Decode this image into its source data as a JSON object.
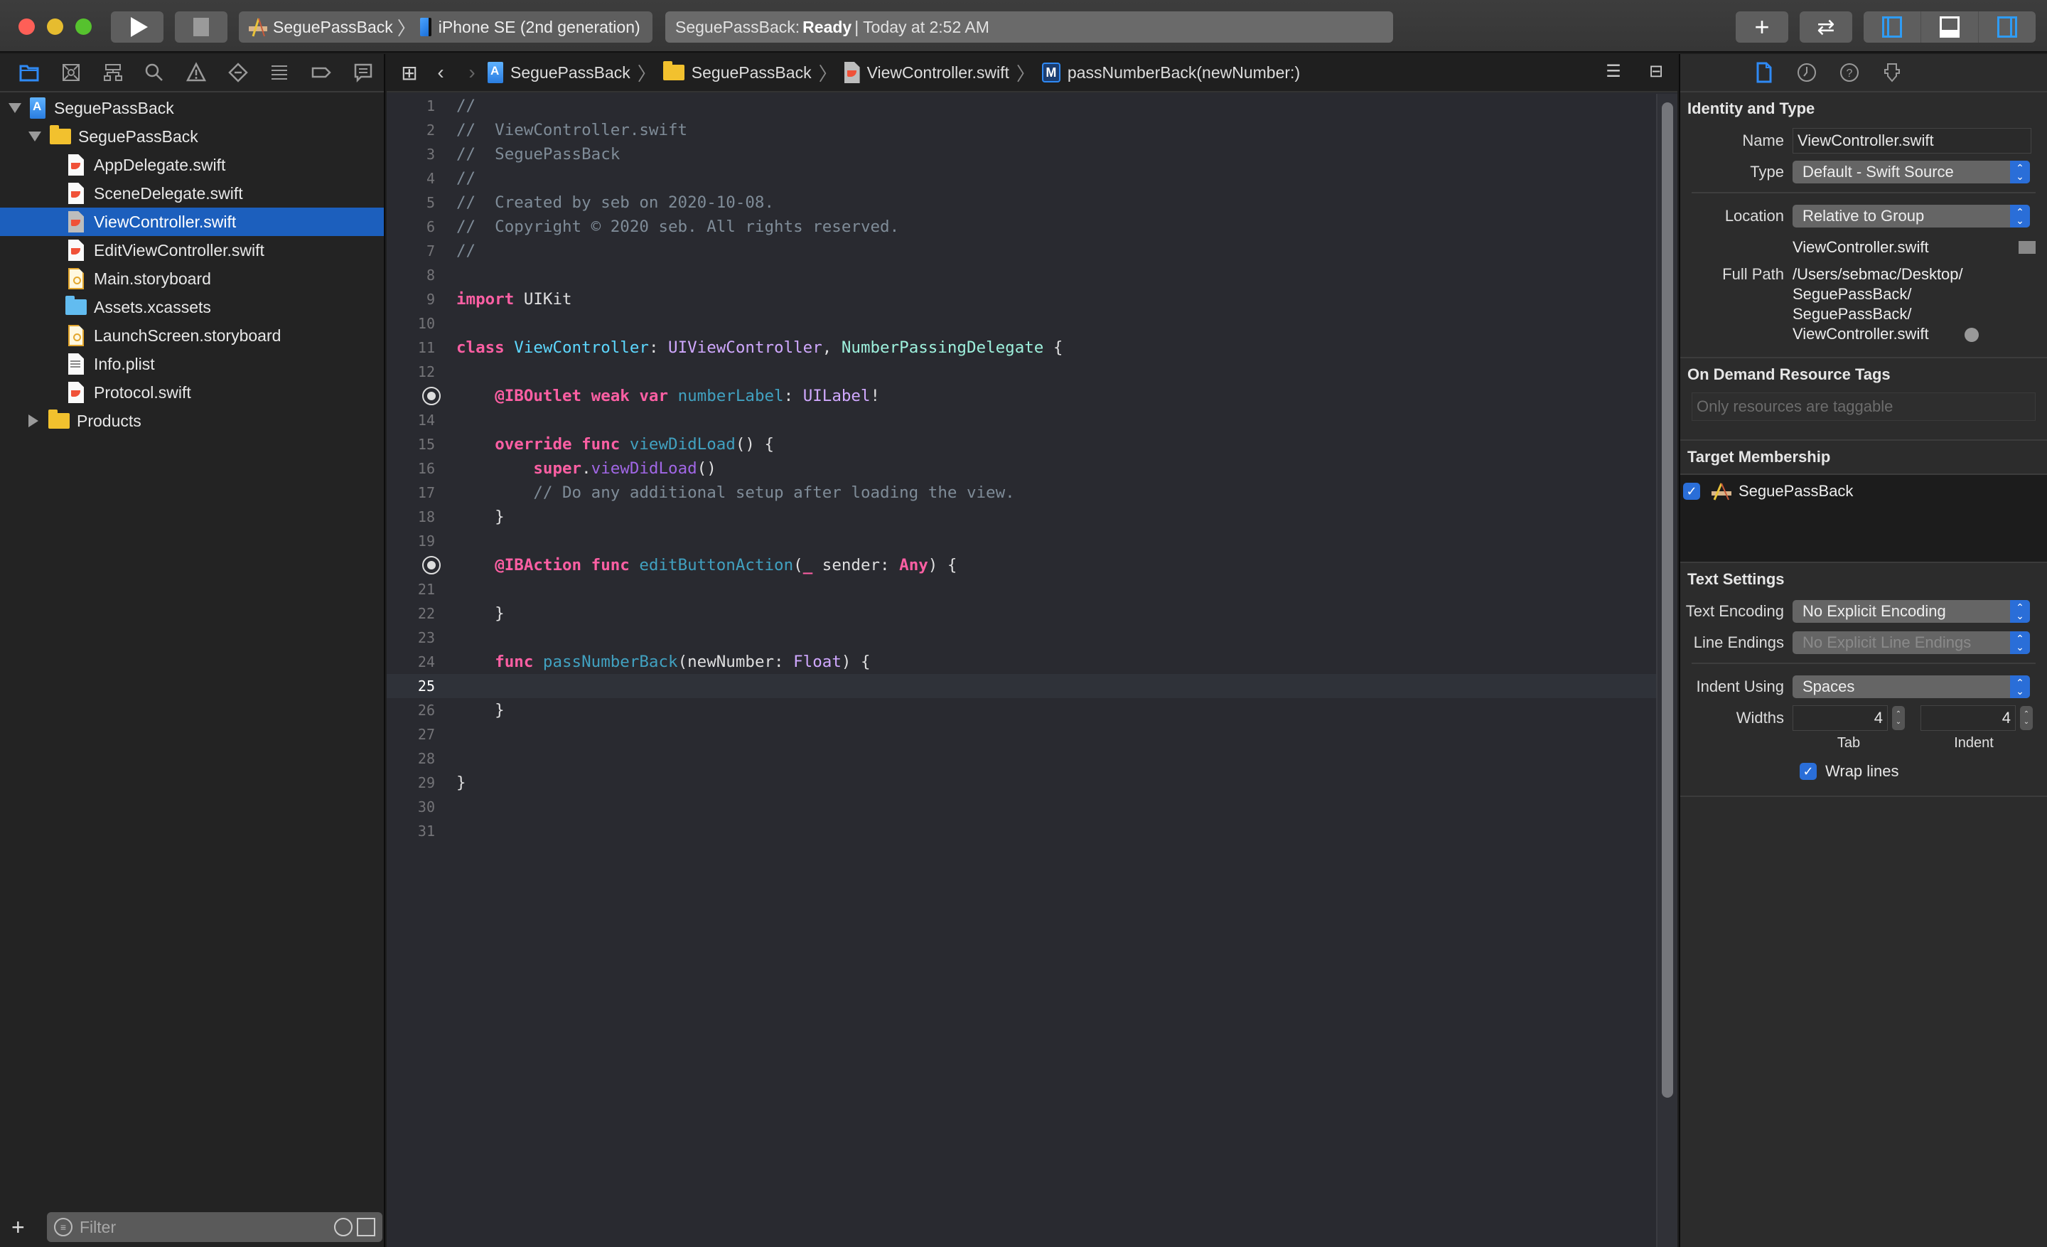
{
  "toolbar": {
    "scheme": "SeguePassBack",
    "destination": "iPhone SE (2nd generation)",
    "activity": {
      "project": "SeguePassBack:",
      "status": "Ready",
      "time": "| Today at 2:52 AM"
    },
    "run_icon": "play-icon",
    "stop_icon": "stop-icon",
    "add_icon": "plus-icon",
    "review_icon": "swap-arrows-icon",
    "pane_icons": [
      "navigator-pane-icon",
      "debug-area-icon",
      "inspector-pane-icon"
    ]
  },
  "navigator": {
    "tabs": [
      {
        "name": "project-navigator",
        "active": true
      },
      {
        "name": "source-control-navigator"
      },
      {
        "name": "symbol-navigator"
      },
      {
        "name": "find-navigator"
      },
      {
        "name": "issue-navigator"
      },
      {
        "name": "test-navigator"
      },
      {
        "name": "debug-navigator"
      },
      {
        "name": "breakpoint-navigator"
      },
      {
        "name": "report-navigator"
      }
    ],
    "tree": [
      {
        "label": "SeguePassBack",
        "kind": "project",
        "depth": 0,
        "expanded": true
      },
      {
        "label": "SeguePassBack",
        "kind": "folder",
        "depth": 1,
        "expanded": true
      },
      {
        "label": "AppDelegate.swift",
        "kind": "swift",
        "depth": 2
      },
      {
        "label": "SceneDelegate.swift",
        "kind": "swift",
        "depth": 2
      },
      {
        "label": "ViewController.swift",
        "kind": "swift",
        "depth": 2,
        "selected": true
      },
      {
        "label": "EditViewController.swift",
        "kind": "swift",
        "depth": 2
      },
      {
        "label": "Main.storyboard",
        "kind": "storyboard",
        "depth": 2
      },
      {
        "label": "Assets.xcassets",
        "kind": "assets",
        "depth": 2
      },
      {
        "label": "LaunchScreen.storyboard",
        "kind": "storyboard",
        "depth": 2
      },
      {
        "label": "Info.plist",
        "kind": "plist",
        "depth": 2
      },
      {
        "label": "Protocol.swift",
        "kind": "swift",
        "depth": 2
      },
      {
        "label": "Products",
        "kind": "folder",
        "depth": 1,
        "expanded": false
      }
    ],
    "filter_placeholder": "Filter"
  },
  "editor": {
    "jumpbar": [
      "SeguePassBack",
      "SeguePassBack",
      "ViewController.swift",
      "passNumberBack(newNumber:)"
    ],
    "method_badge": "M",
    "current_line": 25,
    "lines": [
      [
        [
          "cm",
          "//"
        ]
      ],
      [
        [
          "cm",
          "//  ViewController.swift"
        ]
      ],
      [
        [
          "cm",
          "//  SeguePassBack"
        ]
      ],
      [
        [
          "cm",
          "//"
        ]
      ],
      [
        [
          "cm",
          "//  Created by seb on 2020-10-08."
        ]
      ],
      [
        [
          "cm",
          "//  Copyright © 2020 seb. All rights reserved."
        ]
      ],
      [
        [
          "cm",
          "//"
        ]
      ],
      [],
      [
        [
          "kw",
          "import"
        ],
        [
          "plain",
          " UIKit"
        ]
      ],
      [],
      [
        [
          "kw",
          "class"
        ],
        [
          "plain",
          " "
        ],
        [
          "cls",
          "ViewController"
        ],
        [
          "plain",
          ": "
        ],
        [
          "type",
          "UIViewController"
        ],
        [
          "plain",
          ", "
        ],
        [
          "proto",
          "NumberPassingDelegate"
        ],
        [
          "plain",
          " {"
        ]
      ],
      [],
      [
        [
          "plain",
          "    "
        ],
        [
          "kw",
          "@IBOutlet"
        ],
        [
          "plain",
          " "
        ],
        [
          "kw",
          "weak"
        ],
        [
          "plain",
          " "
        ],
        [
          "kw",
          "var"
        ],
        [
          "plain",
          " "
        ],
        [
          "func",
          "numberLabel"
        ],
        [
          "plain",
          ": "
        ],
        [
          "type",
          "UILabel"
        ],
        [
          "plain",
          "!"
        ]
      ],
      [],
      [
        [
          "plain",
          "    "
        ],
        [
          "kw",
          "override"
        ],
        [
          "plain",
          " "
        ],
        [
          "kw",
          "func"
        ],
        [
          "plain",
          " "
        ],
        [
          "func",
          "viewDidLoad"
        ],
        [
          "plain",
          "() {"
        ]
      ],
      [
        [
          "plain",
          "        "
        ],
        [
          "kw",
          "super"
        ],
        [
          "plain",
          "."
        ],
        [
          "meth",
          "viewDidLoad"
        ],
        [
          "plain",
          "()"
        ]
      ],
      [
        [
          "plain",
          "        "
        ],
        [
          "cm",
          "// Do any additional setup after loading the view."
        ]
      ],
      [
        [
          "plain",
          "    }"
        ]
      ],
      [],
      [
        [
          "plain",
          "    "
        ],
        [
          "kw",
          "@IBAction"
        ],
        [
          "plain",
          " "
        ],
        [
          "kw",
          "func"
        ],
        [
          "plain",
          " "
        ],
        [
          "func",
          "editButtonAction"
        ],
        [
          "plain",
          "("
        ],
        [
          "kw",
          "_"
        ],
        [
          "plain",
          " sender: "
        ],
        [
          "kw",
          "Any"
        ],
        [
          "plain",
          ") {"
        ]
      ],
      [],
      [
        [
          "plain",
          "    }"
        ]
      ],
      [],
      [
        [
          "plain",
          "    "
        ],
        [
          "kw",
          "func"
        ],
        [
          "plain",
          " "
        ],
        [
          "func",
          "passNumberBack"
        ],
        [
          "plain",
          "(newNumber: "
        ],
        [
          "type",
          "Float"
        ],
        [
          "plain",
          ") {"
        ]
      ],
      [],
      [
        [
          "plain",
          "    }"
        ]
      ],
      [],
      [],
      [
        [
          "plain",
          "}"
        ]
      ],
      [],
      []
    ],
    "connection_lines": [
      13,
      20
    ]
  },
  "inspector": {
    "tabs": [
      {
        "name": "file-inspector",
        "active": true
      },
      {
        "name": "history-inspector"
      },
      {
        "name": "quick-help-inspector"
      },
      {
        "name": "accessibility-inspector"
      }
    ],
    "identity": {
      "title": "Identity and Type",
      "name_label": "Name",
      "name_value": "ViewController.swift",
      "type_label": "Type",
      "type_value": "Default - Swift Source",
      "location_label": "Location",
      "location_value": "Relative to Group",
      "location_file": "ViewController.swift",
      "full_path_label": "Full Path",
      "full_path_lines": [
        "/Users/sebmac/Desktop/",
        "SeguePassBack/",
        "SeguePassBack/",
        "ViewController.swift"
      ]
    },
    "odr": {
      "title": "On Demand Resource Tags",
      "placeholder": "Only resources are taggable"
    },
    "target_membership": {
      "title": "Target Membership",
      "targets": [
        {
          "name": "SeguePassBack",
          "checked": true
        }
      ]
    },
    "text_settings": {
      "title": "Text Settings",
      "encoding_label": "Text Encoding",
      "encoding_value": "No Explicit Encoding",
      "line_endings_label": "Line Endings",
      "line_endings_value": "No Explicit Line Endings",
      "indent_label": "Indent Using",
      "indent_value": "Spaces",
      "widths_label": "Widths",
      "tab_width": "4",
      "indent_width": "4",
      "tab_caption": "Tab",
      "indent_caption": "Indent",
      "wrap_label": "Wrap lines",
      "wrap_checked": true
    }
  },
  "colors": {
    "accent": "#2f8af5",
    "selection": "#1c5fbd",
    "editor_bg": "#292a30",
    "keyword": "#fc5fa3",
    "comment": "#7f8c98",
    "class_decl": "#5dd8ff",
    "type": "#d0a8ff",
    "protocol": "#9ef1dd",
    "function": "#41a1c0",
    "method": "#a167e6"
  }
}
